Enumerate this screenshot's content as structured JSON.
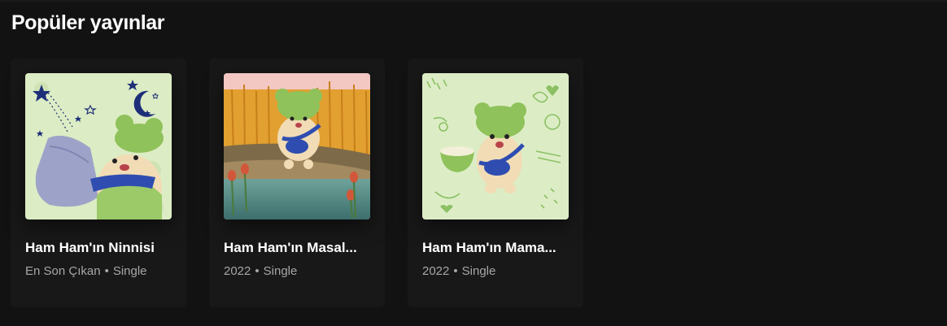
{
  "section": {
    "title": "Popüler yayınlar"
  },
  "releases": [
    {
      "title": "Ham Ham'ın Ninnisi",
      "meta_left": "En Son Çıkan",
      "separator": "•",
      "meta_right": "Single",
      "cover_art": "night-pillow-cover"
    },
    {
      "title": "Ham Ham'ın Masal...",
      "meta_left": "2022",
      "separator": "•",
      "meta_right": "Single",
      "cover_art": "wheat-field-cover"
    },
    {
      "title": "Ham Ham'ın Mama...",
      "meta_left": "2022",
      "separator": "•",
      "meta_right": "Single",
      "cover_art": "food-bowl-cover"
    }
  ],
  "colors": {
    "background": "#121212",
    "card": "#181818",
    "secondary_text": "#a7a7a7",
    "character_green": "#8fc25a"
  }
}
